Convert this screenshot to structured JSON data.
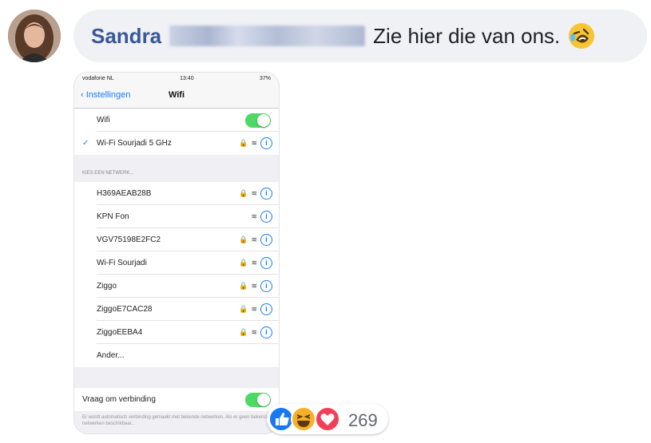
{
  "comment": {
    "author": "Sandra",
    "message": "Zie hier die van ons.",
    "emoji_icon": "rofl-emoji-icon"
  },
  "phone": {
    "status": {
      "carrier": "vodafone NL",
      "time": "13:40",
      "battery": "37%"
    },
    "nav": {
      "back_label": "Instellingen",
      "title": "Wifi"
    },
    "wifi_toggle_label": "Wifi",
    "connected_network": "Wi-Fi Sourjadi 5 GHz",
    "section_header": "KIES EEN NETWERK...",
    "networks": [
      {
        "name": "H369AEAB28B",
        "locked": true
      },
      {
        "name": "KPN Fon",
        "locked": false
      },
      {
        "name": "VGV75198E2FC2",
        "locked": true
      },
      {
        "name": "Wi-Fi Sourjadi",
        "locked": true
      },
      {
        "name": "Ziggo",
        "locked": true
      },
      {
        "name": "ZiggoE7CAC28",
        "locked": true
      },
      {
        "name": "ZiggoEEBA4",
        "locked": true
      }
    ],
    "other_label": "Ander...",
    "ask_to_join_label": "Vraag om verbinding",
    "footer_text": "Er wordt automatisch verbinding gemaakt met bekende netwerken. Als er geen bekende netwerken beschikbaar..."
  },
  "reactions": {
    "count": "269",
    "types": [
      "like",
      "haha",
      "love"
    ]
  },
  "colors": {
    "author": "#385898",
    "bubble": "#f0f1f4",
    "ios_blue": "#1a7cf5",
    "ios_green": "#4cd964",
    "like_blue": "#1877f2",
    "love_red": "#f33e58",
    "haha_yellow": "#f7b125"
  }
}
